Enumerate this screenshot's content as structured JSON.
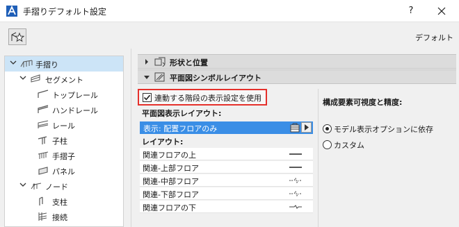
{
  "window": {
    "title": "手摺りデフォルト設定",
    "help_label": "?",
    "close_label": "✕"
  },
  "toolbar": {
    "default_label": "デフォルト",
    "favorites_icon": "favorites-star-icon"
  },
  "tree": {
    "items": [
      {
        "label": "手摺り",
        "level": 0,
        "expanded": true,
        "selected": true,
        "icon": "railing-icon"
      },
      {
        "label": "セグメント",
        "level": 1,
        "expanded": true,
        "icon": "segment-icon"
      },
      {
        "label": "トップレール",
        "level": 2,
        "icon": "top-rail-icon"
      },
      {
        "label": "ハンドレール",
        "level": 2,
        "icon": "handrail-icon"
      },
      {
        "label": "レール",
        "level": 2,
        "icon": "rail-icon"
      },
      {
        "label": "子柱",
        "level": 2,
        "icon": "baluster-post-icon"
      },
      {
        "label": "手摺子",
        "level": 2,
        "icon": "baluster-icon"
      },
      {
        "label": "パネル",
        "level": 2,
        "icon": "panel-icon"
      },
      {
        "label": "ノード",
        "level": 1,
        "expanded": true,
        "icon": "node-icon"
      },
      {
        "label": "支柱",
        "level": 2,
        "icon": "post-icon"
      },
      {
        "label": "接続",
        "level": 2,
        "icon": "connection-icon"
      }
    ]
  },
  "sections": {
    "shape_position": {
      "title": "形状と位置",
      "expanded": false
    },
    "plan_symbol": {
      "title": "平面図シンボルレイアウト",
      "expanded": true
    }
  },
  "plan": {
    "use_stair_display_label": "連動する階段の表示設定を使用",
    "use_stair_display_checked": true,
    "plan_display_layout_label": "平面図表示レイアウト:",
    "display_selected": "表示: 配置フロアのみ",
    "layout_label": "レイアウト:",
    "layers": [
      {
        "name": "関連フロアの上",
        "line_style": "solid"
      },
      {
        "name": "関連-上部フロア",
        "line_style": "solid"
      },
      {
        "name": "関連-中部フロア",
        "line_style": "dashed-break"
      },
      {
        "name": "関連-下部フロア",
        "line_style": "dashed-break"
      },
      {
        "name": "関連フロアの下",
        "line_style": "short-break"
      }
    ]
  },
  "visibility": {
    "title": "構成要素可視度と精度:",
    "options": [
      {
        "label": "モデル表示オプションに依存",
        "selected": true
      },
      {
        "label": "カスタム",
        "selected": false
      }
    ]
  }
}
